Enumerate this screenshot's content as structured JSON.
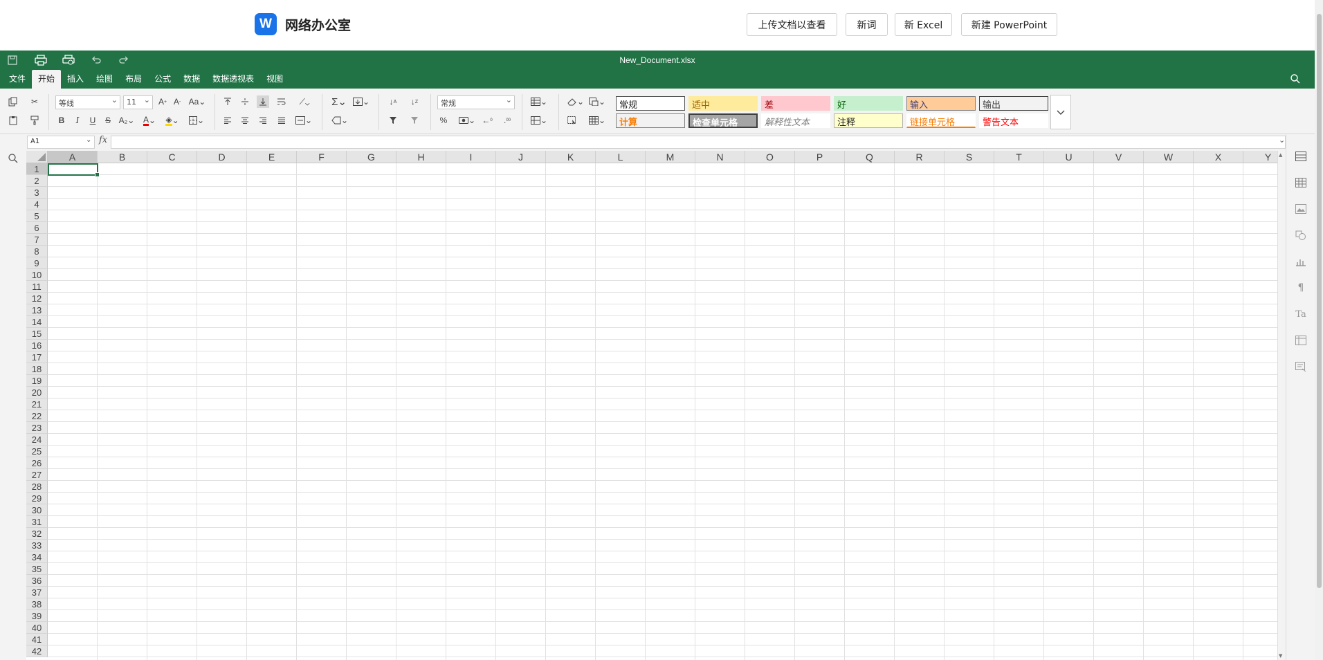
{
  "header": {
    "logo_letter": "W",
    "title": "网络办公室",
    "buttons": [
      "上传文档以查看",
      "新词",
      "新 Excel",
      "新建 PowerPoint"
    ]
  },
  "titlebar": {
    "filename": "New_Document.xlsx"
  },
  "menu": {
    "tabs": [
      "文件",
      "开始",
      "插入",
      "绘图",
      "布局",
      "公式",
      "数据",
      "数据透视表",
      "视图"
    ],
    "active": "开始"
  },
  "ribbon": {
    "font_name": "等线",
    "font_size": "11",
    "number_format": "常规",
    "styles": [
      {
        "label": "常规",
        "bg": "#ffffff",
        "color": "#222222",
        "border": "#555555"
      },
      {
        "label": "适中",
        "bg": "#ffeb9c",
        "color": "#9c6500",
        "border": "#ffeb9c"
      },
      {
        "label": "差",
        "bg": "#ffc7ce",
        "color": "#9c0006",
        "border": "#ffc7ce"
      },
      {
        "label": "好",
        "bg": "#c6efce",
        "color": "#006100",
        "border": "#c6efce"
      },
      {
        "label": "输入",
        "bg": "#ffcc99",
        "color": "#3f3f76",
        "border": "#7f7f7f"
      },
      {
        "label": "输出",
        "bg": "#f2f2f2",
        "color": "#3f3f3f",
        "border": "#3f3f3f"
      },
      {
        "label": "计算",
        "bg": "#f2f2f2",
        "color": "#fa7d00",
        "border": "#7f7f7f"
      },
      {
        "label": "检查单元格",
        "bg": "#a5a5a5",
        "color": "#ffffff",
        "border": "#3f3f3f"
      },
      {
        "label": "解释性文本",
        "bg": "#ffffff",
        "color": "#7f7f7f",
        "border": "#ffffff"
      },
      {
        "label": "注释",
        "bg": "#ffffcc",
        "color": "#222222",
        "border": "#b2b2b2"
      },
      {
        "label": "链接单元格",
        "bg": "#ffffff",
        "color": "#fa7d00",
        "border": "#ffffff"
      },
      {
        "label": "警告文本",
        "bg": "#ffffff",
        "color": "#ff0000",
        "border": "#ffffff"
      }
    ]
  },
  "formula_bar": {
    "cell_ref": "A1",
    "fx_label": "fx",
    "formula": ""
  },
  "sheet": {
    "columns": [
      "A",
      "B",
      "C",
      "D",
      "E",
      "F",
      "G",
      "H",
      "I",
      "J",
      "K",
      "L",
      "M",
      "N",
      "O",
      "P",
      "Q",
      "R",
      "S",
      "T",
      "U",
      "V",
      "W",
      "X",
      "Y"
    ],
    "row_count": 42,
    "selected_cell": "A1"
  },
  "colors": {
    "accent": "#217346",
    "brand": "#1a73e8"
  }
}
